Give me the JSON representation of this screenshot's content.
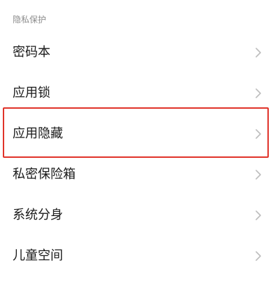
{
  "section": {
    "title": "隐私保护"
  },
  "items": [
    {
      "label": "密码本",
      "icon": "chevron-right-icon"
    },
    {
      "label": "应用锁",
      "icon": "chevron-right-icon"
    },
    {
      "label": "应用隐藏",
      "icon": "chevron-right-icon"
    },
    {
      "label": "私密保险箱",
      "icon": "chevron-right-icon"
    },
    {
      "label": "系统分身",
      "icon": "chevron-right-icon"
    },
    {
      "label": "儿童空间",
      "icon": "chevron-right-icon"
    }
  ],
  "colors": {
    "highlight": "#e0332a",
    "header_text": "#8c8c8c",
    "item_text": "#1a1a1a",
    "chevron": "#bdbdbd"
  }
}
